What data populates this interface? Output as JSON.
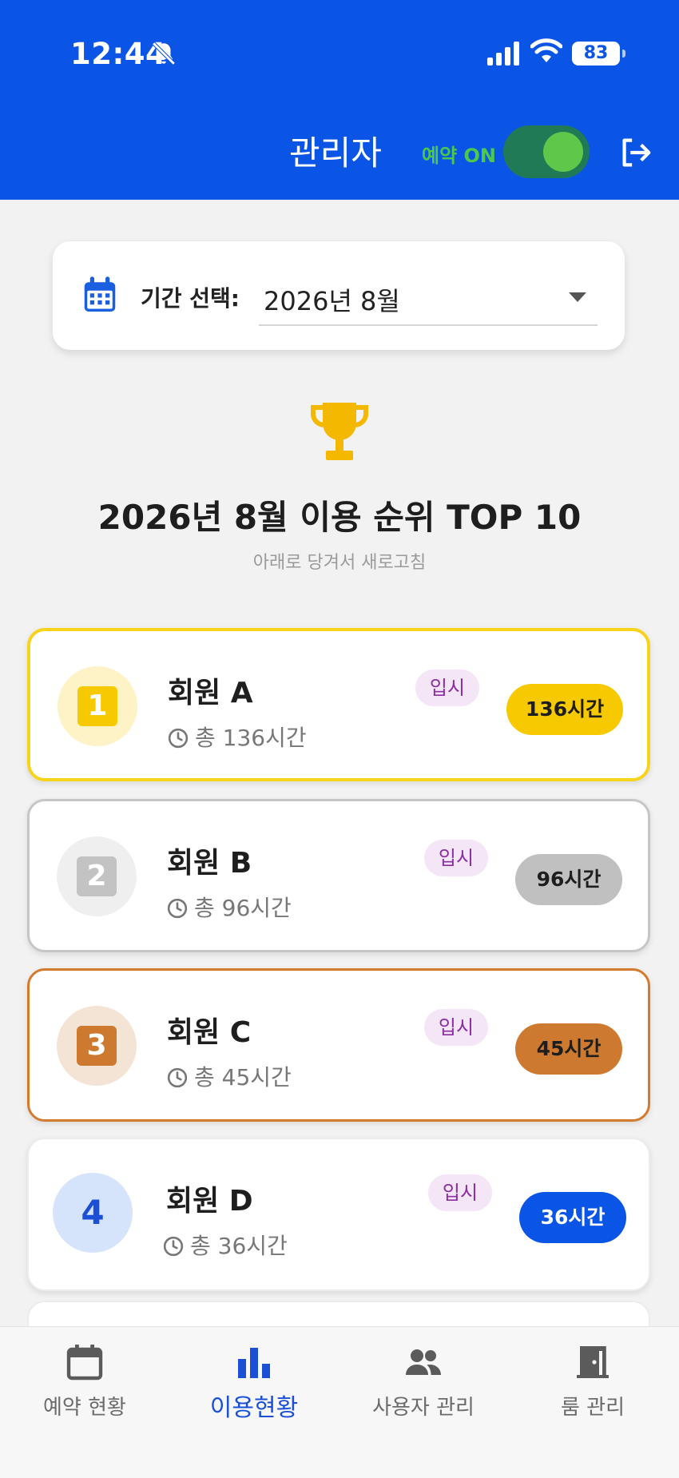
{
  "status_bar": {
    "time": "12:44",
    "battery": "83"
  },
  "header": {
    "title": "관리자",
    "reservation_label": "예약 ON",
    "reservation_on": true,
    "accent_color": "#0a54e6"
  },
  "period": {
    "label": "기간 선택:",
    "value": "2026년 8월"
  },
  "ranking": {
    "title": "2026년 8월 이용 순위 TOP 10",
    "hint": "아래로 당겨서 새로고침",
    "members": [
      {
        "rank": "1",
        "name": "회원 A",
        "category": "입시",
        "total": "총 136시간",
        "hours": "136시간",
        "color": "#f7c900"
      },
      {
        "rank": "2",
        "name": "회원 B",
        "category": "입시",
        "total": "총 96시간",
        "hours": "96시간",
        "color": "#c0c0c0"
      },
      {
        "rank": "3",
        "name": "회원 C",
        "category": "입시",
        "total": "총 45시간",
        "hours": "45시간",
        "color": "#cd7a30"
      },
      {
        "rank": "4",
        "name": "회원 D",
        "category": "입시",
        "total": "총 36시간",
        "hours": "36시간",
        "color": "#0a54e6"
      }
    ]
  },
  "bottom_nav": {
    "items": [
      {
        "label": "예약 현황",
        "icon": "calendar-icon"
      },
      {
        "label": "이용현황",
        "icon": "bar-chart-icon",
        "active": true
      },
      {
        "label": "사용자 관리",
        "icon": "people-icon"
      },
      {
        "label": "룸 관리",
        "icon": "door-icon"
      }
    ]
  }
}
